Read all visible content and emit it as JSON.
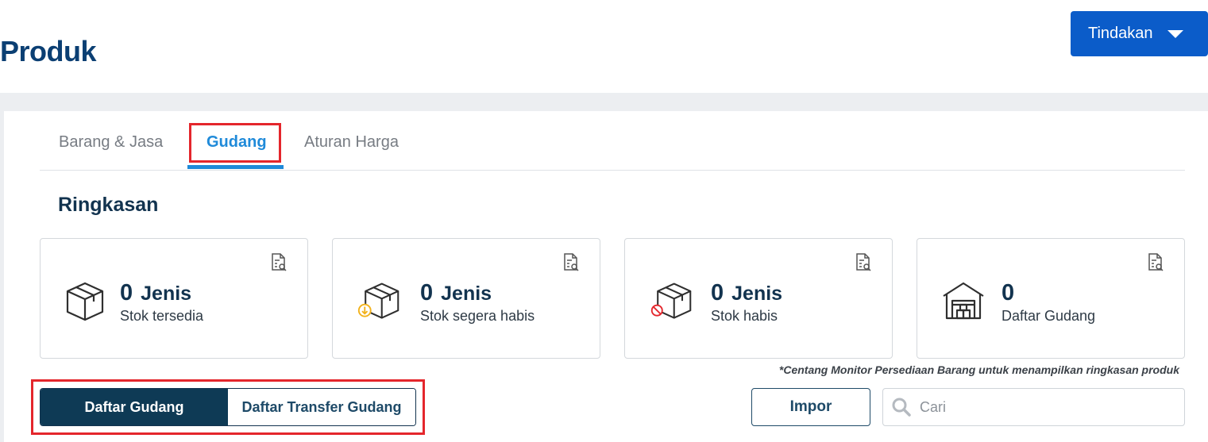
{
  "header": {
    "title": "Produk",
    "action_label": "Tindakan"
  },
  "tabs": [
    {
      "label": "Barang & Jasa",
      "active": false
    },
    {
      "label": "Gudang",
      "active": true
    },
    {
      "label": "Aturan Harga",
      "active": false
    }
  ],
  "summary": {
    "title": "Ringkasan",
    "cards": [
      {
        "value": "0",
        "unit": "Jenis",
        "label": "Stok tersedia",
        "icon": "box-icon"
      },
      {
        "value": "0",
        "unit": "Jenis",
        "label": "Stok segera habis",
        "icon": "box-low-stock-icon"
      },
      {
        "value": "0",
        "unit": "Jenis",
        "label": "Stok habis",
        "icon": "box-out-of-stock-icon"
      },
      {
        "value": "0",
        "unit": "",
        "label": "Daftar Gudang",
        "icon": "warehouse-icon"
      }
    ],
    "note": "*Centang Monitor Persediaan Barang untuk menampilkan ringkasan produk"
  },
  "toolbar": {
    "segments": [
      "Daftar Gudang",
      "Daftar Transfer Gudang"
    ],
    "active_segment": "Daftar Gudang",
    "import_label": "Impor",
    "search_placeholder": "Cari"
  },
  "colors": {
    "primary_blue": "#0b5cc9",
    "title_navy": "#0b3f73",
    "tab_active": "#1f8ad9",
    "dark_teal": "#0e3a55",
    "highlight_red": "#e4262c",
    "warning_yellow": "#f2b21b"
  }
}
